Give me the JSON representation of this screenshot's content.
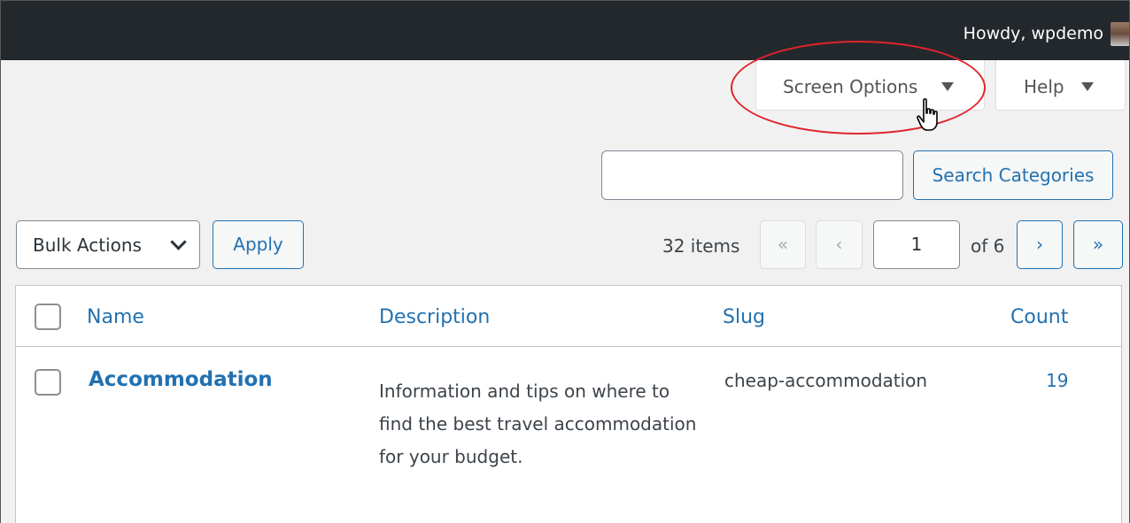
{
  "admin_bar": {
    "greeting": "Howdy, wpdemo"
  },
  "screen_meta": {
    "screen_options_label": "Screen Options",
    "help_label": "Help"
  },
  "search": {
    "value": "",
    "button_label": "Search Categories"
  },
  "tablenav": {
    "bulk_actions_selected": "Bulk Actions",
    "apply_label": "Apply",
    "items_count": "32 items",
    "first_page": "«",
    "prev_page": "‹",
    "current_page": "1",
    "of_pages": "of 6",
    "next_page": "›",
    "last_page": "»"
  },
  "table": {
    "columns": [
      "Name",
      "Description",
      "Slug",
      "Count"
    ],
    "rows": [
      {
        "name": "Accommodation",
        "description": "Information and tips on where to find the best travel accommodation for your budget.",
        "slug": "cheap-accommodation",
        "count": "19"
      }
    ]
  },
  "colors": {
    "admin_bar": "#23282d",
    "link_blue": "#2271b1",
    "highlight_ring": "#e0242a",
    "page_bg": "#f1f1f1"
  },
  "icons": [
    "caret-down-icon",
    "chevron-down-icon",
    "hand-pointer-cursor-icon",
    "avatar"
  ]
}
